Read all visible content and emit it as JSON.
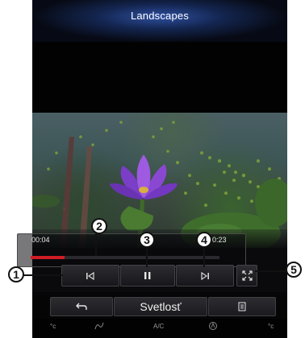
{
  "header": {
    "title": "Landscapes"
  },
  "player": {
    "time_elapsed": "00:04",
    "time_total": "00:23",
    "progress": 0.18,
    "progress_color": "#d01c24",
    "buttons": {
      "previous_icon": "skip-previous-icon",
      "pause_icon": "pause-icon",
      "next_icon": "skip-next-icon",
      "fullscreen_icon": "fullscreen-icon"
    }
  },
  "bottom_bar": {
    "back_icon": "back-arrow-icon",
    "center_label": "Svetlosť",
    "menu_icon": "list-menu-icon"
  },
  "status": {
    "left_temp": "°c",
    "fan_icon": "fan-icon",
    "ac_label": "A/C",
    "auto_icon": "auto-climate-icon",
    "right_temp": "°c"
  },
  "callouts": [
    "1",
    "2",
    "3",
    "4",
    "5"
  ]
}
